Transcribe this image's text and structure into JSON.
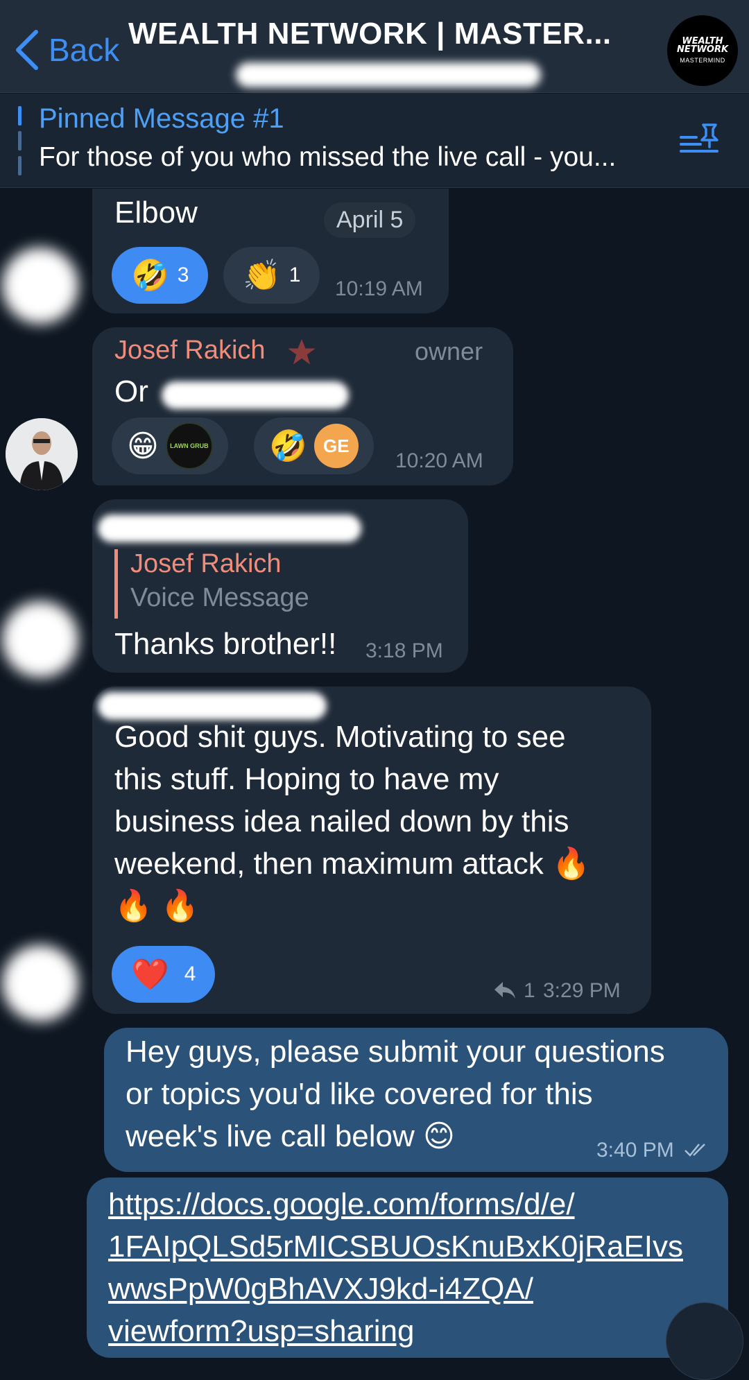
{
  "header": {
    "back_label": "Back",
    "title": "WEALTH NETWORK | MASTER...",
    "logo": {
      "line1": "WEALTH",
      "line2": "NETWORK",
      "line3": "MASTERMIND"
    }
  },
  "pinned": {
    "title": "Pinned Message #1",
    "text": "For those of you who missed the live call - you..."
  },
  "messages": {
    "m1": {
      "text": "Elbow",
      "date_chip": "April 5",
      "time": "10:19 AM",
      "reactions": [
        {
          "emoji": "🤣",
          "count": "3"
        },
        {
          "emoji": "👏",
          "count": "1"
        }
      ]
    },
    "m2": {
      "sender": "Josef Rakich",
      "role": "owner",
      "text_start": "Or",
      "time": "10:20 AM",
      "reactions": [
        {
          "emoji": "😁",
          "avatar": "LAWN GRUB"
        },
        {
          "emoji": "🤣",
          "avatar": "GE"
        }
      ]
    },
    "m3": {
      "reply_name": "Josef Rakich",
      "reply_text": "Voice Message",
      "text": "Thanks brother!!",
      "time": "3:18 PM"
    },
    "m4": {
      "lines": [
        "Good shit guys. Motivating to see",
        "this stuff. Hoping to have my",
        "business idea nailed down by this",
        "weekend, then maximum attack 🔥",
        "🔥 🔥"
      ],
      "reaction": {
        "emoji": "❤️",
        "count": "4"
      },
      "replies": "1",
      "time": "3:29 PM"
    },
    "m5": {
      "lines": [
        "Hey guys, please submit your questions",
        "or topics you'd like covered for this",
        "week's live call below 😊"
      ],
      "time": "3:40 PM"
    },
    "m6": {
      "lines": [
        "https://docs.google.com/forms/d/e/",
        "1FAIpQLSd5rMICSBUOsKnuBxK0jRaEIvs",
        "wwsPpW0gBhAVXJ9kd-i4ZQA/",
        "viewform?usp=sharing"
      ]
    }
  },
  "colors": {
    "background": "#0e1621",
    "accent": "#3d8ff5",
    "incoming_bubble": "#1f2a38",
    "outgoing_bubble": "#2b5278",
    "sender_name": "#f28c7a"
  }
}
